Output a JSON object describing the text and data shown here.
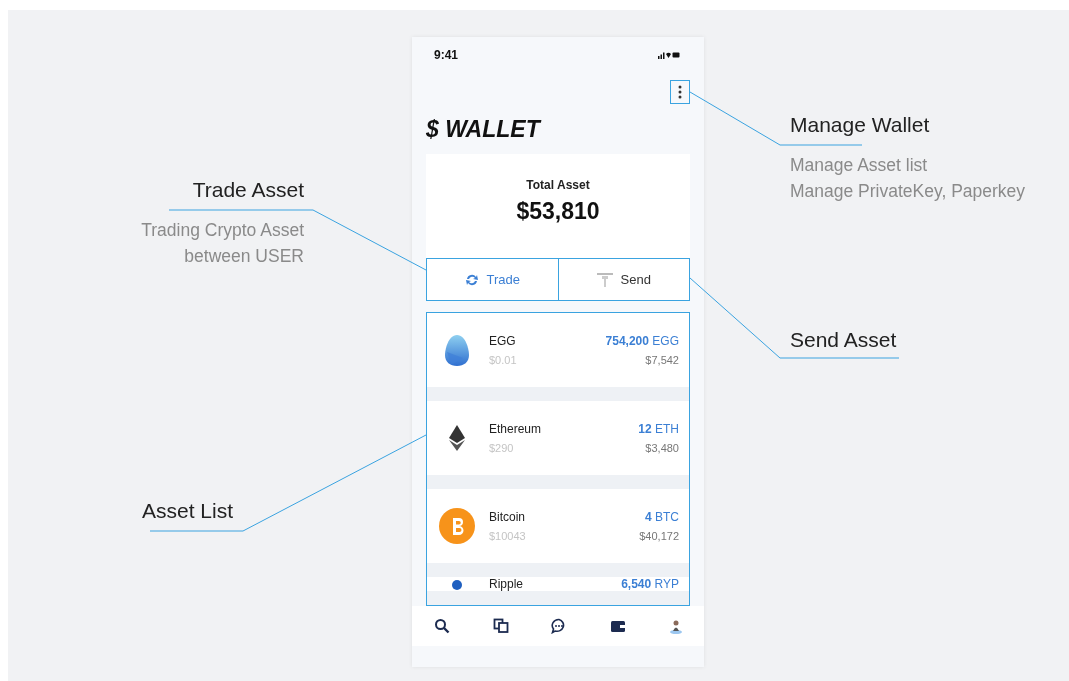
{
  "phone": {
    "status_bar": {
      "time": "9:41"
    },
    "title": "$ WALLET",
    "total": {
      "label": "Total Asset",
      "value": "$53,810"
    },
    "actions": [
      {
        "kind": "trade",
        "label": "Trade"
      },
      {
        "kind": "send",
        "label": "Send"
      }
    ],
    "assets": [
      {
        "kind": "egg",
        "name": "EGG",
        "price": "$0.01",
        "amount": "**754,200** EGG",
        "value": "$7,542"
      },
      {
        "kind": "ether",
        "name": "Ethereum",
        "price": "$290",
        "amount": "**12** ETH",
        "value": "$3,480"
      },
      {
        "kind": "coin",
        "name": "Bitcoin",
        "price": "$10043",
        "amount": "**4** BTC",
        "value": "$40,172"
      },
      {
        "kind": "dot",
        "name": "Ripple",
        "amount": "**6,540** RYP"
      }
    ]
  },
  "annotations": [
    {
      "kind": "manage",
      "title": "Manage Wallet",
      "lines": [
        "Manage Asset list",
        "Manage PrivateKey, Paperkey"
      ]
    },
    {
      "kind": "trade",
      "title": "Trade Asset",
      "lines": [
        "Trading Crypto Asset",
        "between USER"
      ]
    },
    {
      "kind": "send",
      "title": "Send Asset"
    },
    {
      "kind": "list",
      "title": "Asset List"
    }
  ]
}
